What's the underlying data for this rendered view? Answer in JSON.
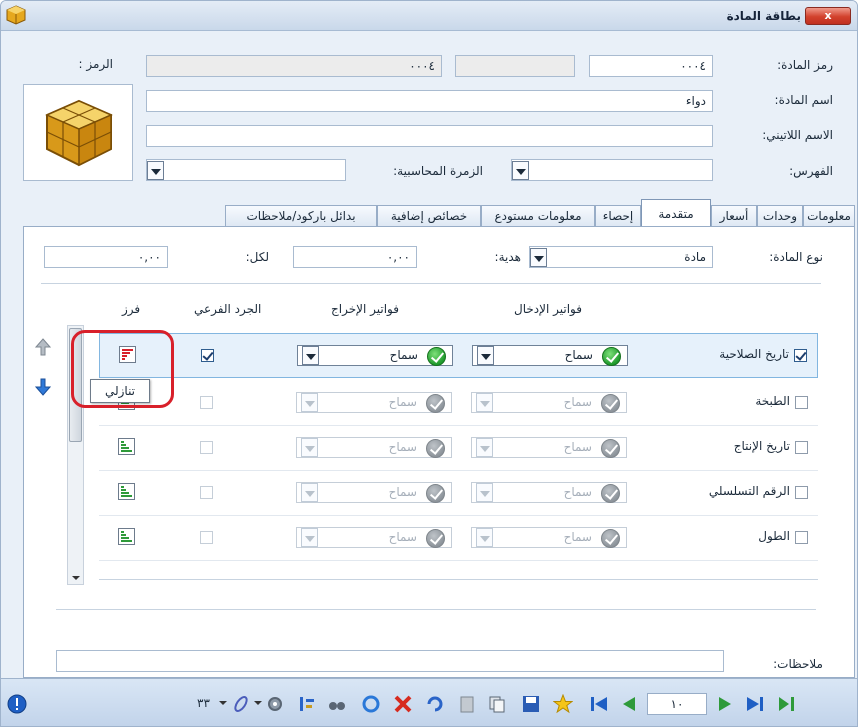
{
  "window": {
    "title": "بطاقة المادة",
    "close_label": "x"
  },
  "form": {
    "code_label": "رمز المادة:",
    "code_value": "٠٠٠٤",
    "code_value_2": "٠٠٠٤",
    "symbol_label": "الرمز :",
    "name_label": "اسم المادة:",
    "name_value": "دواء",
    "latin_label": "الاسم اللاتيني:",
    "latin_value": "",
    "index_label": "الفهرس:",
    "acc_group_label": "الزمرة المحاسبية:"
  },
  "tabs": [
    {
      "label": "معلومات"
    },
    {
      "label": "وحدات"
    },
    {
      "label": "أسعار"
    },
    {
      "label": "متقدمة",
      "active": true
    },
    {
      "label": "إحصاء"
    },
    {
      "label": "معلومات مستودع"
    },
    {
      "label": "خصائص إضافية"
    },
    {
      "label": "بدائل باركود/ملاحظات"
    }
  ],
  "advanced": {
    "type_label": "نوع المادة:",
    "type_value": "مادة",
    "gift_label": "هدية:",
    "gift_value": "٠,٠٠",
    "per_label": "لكل:",
    "per_value": "٠,٠٠",
    "columns": {
      "input_invoices": "فواتير الإدخال",
      "output_invoices": "فواتير الإخراج",
      "sub_inventory": "الجرد الفرعي",
      "sort": "فرز"
    },
    "rows": [
      {
        "label": "تاريخ الصلاحية",
        "checked": true,
        "input": "سماح",
        "output": "سماح",
        "sub": true,
        "active": true
      },
      {
        "label": "الطبخة",
        "checked": false,
        "input": "سماح",
        "output": "سماح",
        "sub": false,
        "active": false
      },
      {
        "label": "تاريخ الإنتاج",
        "checked": false,
        "input": "سماح",
        "output": "سماح",
        "sub": false,
        "active": false
      },
      {
        "label": "الرقم التسلسلي",
        "checked": false,
        "input": "سماح",
        "output": "سماح",
        "sub": false,
        "active": false
      },
      {
        "label": "الطول",
        "checked": false,
        "input": "سماح",
        "output": "سماح",
        "sub": false,
        "active": false
      }
    ],
    "tooltip": "تنازلي",
    "notes_label": "ملاحظات:",
    "notes_value": ""
  },
  "toolbar": {
    "record_number": "١٠",
    "count_label": "٣٣"
  },
  "colors": {
    "accent": "#82b6e0",
    "highlight": "#d8202a",
    "ok_green": "#1f9a2c"
  }
}
